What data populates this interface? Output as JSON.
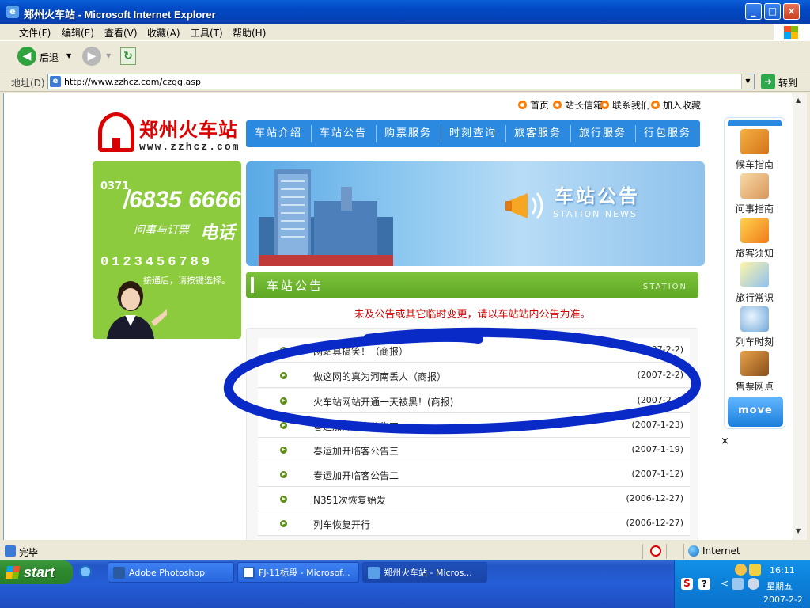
{
  "window": {
    "title": "郑州火车站 - Microsoft Internet Explorer",
    "controls": {
      "minimize": "_",
      "maximize": "□",
      "close": "×"
    }
  },
  "menu": [
    "文件(F)",
    "编辑(E)",
    "查看(V)",
    "收藏(A)",
    "工具(T)",
    "帮助(H)"
  ],
  "toolbar": {
    "back_label": "后退"
  },
  "address": {
    "label": "地址(D)",
    "url": "http://www.zzhcz.com/czgg.asp",
    "go_label": "转到"
  },
  "page": {
    "top_links": [
      "首页",
      "站长信箱",
      "联系我们",
      "加入收藏"
    ],
    "logo": {
      "name": "郑州火车站",
      "url": "www.zzhcz.com"
    },
    "nav": [
      "车站介绍",
      "车站公告",
      "购票服务",
      "时刻查询",
      "旅客服务",
      "旅行服务",
      "行包服务"
    ],
    "phone": {
      "area": "0371",
      "number": "6835 6666",
      "sub": "问事与订票",
      "sub2": "电话",
      "digits": "0123456789",
      "hint": "接通后，请按键选择。"
    },
    "banner": {
      "title": "车站公告",
      "subtitle": "STATION NEWS"
    },
    "section": {
      "title": "车站公告",
      "en": "STATION"
    },
    "notice": "未及公告或其它临时变更，请以车站站内公告为准。",
    "announcements": [
      {
        "title": "网站真搞笑！（商报）",
        "date": "(2007-2-2)"
      },
      {
        "title": "做这网的真为河南丢人（商报）",
        "date": "(2007-2-2)"
      },
      {
        "title": "火车站网站开通一天被黑！(商报)",
        "date": "(2007-2-2)"
      },
      {
        "title": "春运加开临客公告四",
        "date": "(2007-1-23)"
      },
      {
        "title": "春运加开临客公告三",
        "date": "(2007-1-19)"
      },
      {
        "title": "春运加开临客公告二",
        "date": "(2007-1-12)"
      },
      {
        "title": "N351次恢复始发",
        "date": "(2006-12-27)"
      },
      {
        "title": "列车恢复开行",
        "date": "(2006-12-27)"
      }
    ],
    "side_panel": {
      "items": [
        "候车指南",
        "问事指南",
        "旅客须知",
        "旅行常识",
        "列车时刻",
        "售票网点"
      ],
      "move_label": "move",
      "close": "×"
    }
  },
  "status": {
    "text": "完毕",
    "zone": "Internet"
  },
  "taskbar": {
    "start": "start",
    "tasks": [
      "Adobe Photoshop",
      "FJ-11标段 - Microsof...",
      "郑州火车站 - Micros..."
    ],
    "clock": "16:11",
    "weekday": "星期五",
    "date": "2007-2-2"
  },
  "colors": {
    "title_bar": "#0348c4",
    "nav_blue": "#2b8ae0",
    "green": "#8ccb3e",
    "notice_red": "#d40000",
    "scribble": "#0a2ac8"
  }
}
